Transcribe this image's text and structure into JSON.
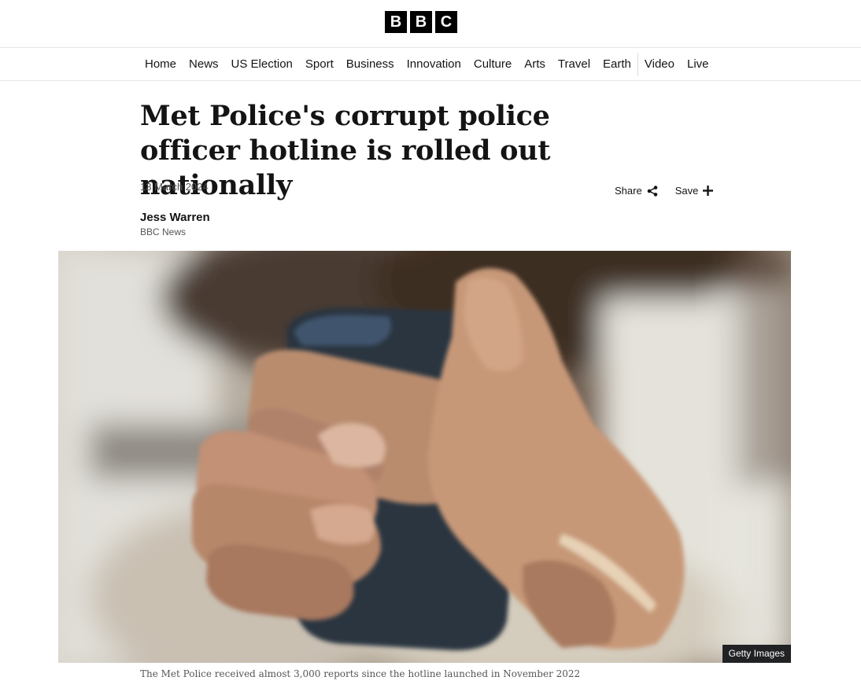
{
  "masthead": {
    "logo_letters": [
      "B",
      "B",
      "C"
    ]
  },
  "nav": {
    "items": [
      "Home",
      "News",
      "US Election",
      "Sport",
      "Business",
      "Innovation",
      "Culture",
      "Arts",
      "Travel",
      "Earth"
    ],
    "extra_items": [
      "Video",
      "Live"
    ]
  },
  "article": {
    "headline": "Met Police's corrupt police officer hotline is rolled out nationally",
    "date": "13 March 2024",
    "share_label": "Share",
    "save_label": "Save",
    "share_icon": "share-icon",
    "save_icon": "plus-icon",
    "author": "Jess Warren",
    "author_org": "BBC News"
  },
  "image": {
    "subject": "hands-holding-phone",
    "credit": "Getty Images",
    "caption": "The Met Police received almost 3,000 reports since the hotline launched in November 2022"
  }
}
